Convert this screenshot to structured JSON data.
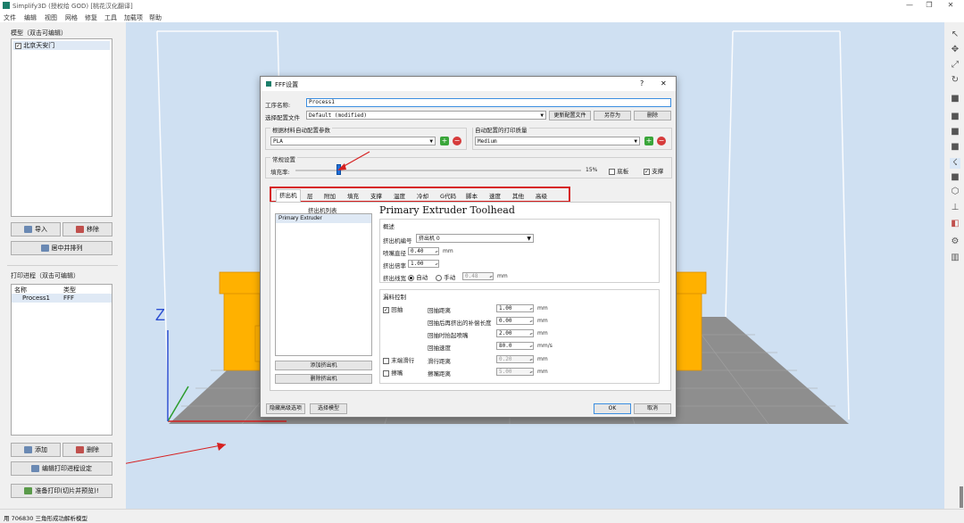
{
  "window": {
    "title": "Simplify3D (授权给 GOD) [桃花汉化翻译]",
    "controls": [
      "—",
      "❐",
      "✕"
    ]
  },
  "menu": [
    "文件",
    "编辑",
    "视图",
    "网格",
    "修复",
    "工具",
    "加载项",
    "帮助"
  ],
  "models_panel": {
    "title": "模型（双击可编辑）",
    "items": [
      {
        "label": "北京天安门",
        "checked": true
      }
    ],
    "import_label": "导入",
    "remove_label": "移除",
    "center_arrange_label": "居中并排列"
  },
  "process_panel": {
    "title": "打印进程（双击可编辑）",
    "col_name": "名称",
    "col_type": "类型",
    "rows": [
      {
        "name": "Process1",
        "type": "FFF"
      }
    ],
    "add_label": "添加",
    "delete_label": "删除",
    "edit_label": "编辑打印进程设定",
    "prepare_label": "准备打印(切片并预览)!"
  },
  "viewport": {
    "axis_z": "Z"
  },
  "status_text": "用 706830 三角形成功解析模型",
  "dialog": {
    "title": "FFF设置",
    "help": "?",
    "close": "✕",
    "process_name_label": "工序名称:",
    "process_name_value": "Process1",
    "profile_label": "选择配置文件",
    "profile_value": "Default (modified)",
    "update_profile_label": "更新配置文件",
    "save_as_label": "另存为",
    "delete_label": "删除",
    "material_group_label": "根据材料自动配置参数",
    "material_value": "PLA",
    "quality_group_label": "自动配置的打印质量",
    "quality_value": "Medium",
    "general_label": "常规设置",
    "infill_label": "填充率:",
    "infill_percent": "15%",
    "infill_fraction": 0.15,
    "raft_label": "底板",
    "raft_checked": false,
    "support_label": "支撑",
    "support_checked": true,
    "tabs": [
      "挤出机",
      "层",
      "附加",
      "填充",
      "支撑",
      "温度",
      "冷却",
      "G代码",
      "脚本",
      "速度",
      "其他",
      "高级"
    ],
    "extruder_list_title": "挤出机列表",
    "extruder_list": [
      "Primary Extruder"
    ],
    "add_extruder_label": "添加挤出机",
    "remove_extruder_label": "删除挤出机",
    "toolhead_title": "Primary Extruder Toolhead",
    "overview_label": "概述",
    "extruder_number_label": "挤出机编号",
    "extruder_number_value": "挤出机 0",
    "nozzle_label": "喷嘴直径",
    "nozzle_value": "0.40",
    "multiplier_label": "挤出倍率",
    "multiplier_value": "1.00",
    "width_label": "挤出线宽",
    "width_auto_label": "自动",
    "width_manual_label": "手动",
    "width_value": "0.48",
    "ooze_label": "漏料控制",
    "retract_label": "回抽",
    "retract_checked": true,
    "retract_distance_label": "回抽距离",
    "retract_distance_value": "1.00",
    "extra_restart_label": "回抽后再挤出的补偿长度",
    "extra_restart_value": "0.00",
    "vertical_lift_label": "回抽时抬起喷嘴",
    "vertical_lift_value": "2.00",
    "retract_speed_label": "回抽速度",
    "retract_speed_value": "80.0",
    "coast_label": "末端滑行",
    "coast_checked": false,
    "coast_distance_label": "滑行距离",
    "coast_distance_value": "0.20",
    "wipe_label": "擦嘴",
    "wipe_checked": false,
    "wipe_distance_label": "擦嘴距离",
    "wipe_distance_value": "5.00",
    "unit_mm": "mm",
    "unit_mms": "mm/s",
    "hide_advanced_label": "隐藏高级选项",
    "select_models_label": "选择模型",
    "ok_label": "OK",
    "cancel_label": "取消"
  },
  "colors": {
    "accent_red": "#d62020",
    "model_orange": "#ffb100",
    "bed_gray": "#8e8e8e",
    "slider_blue": "#1e6fd9"
  }
}
